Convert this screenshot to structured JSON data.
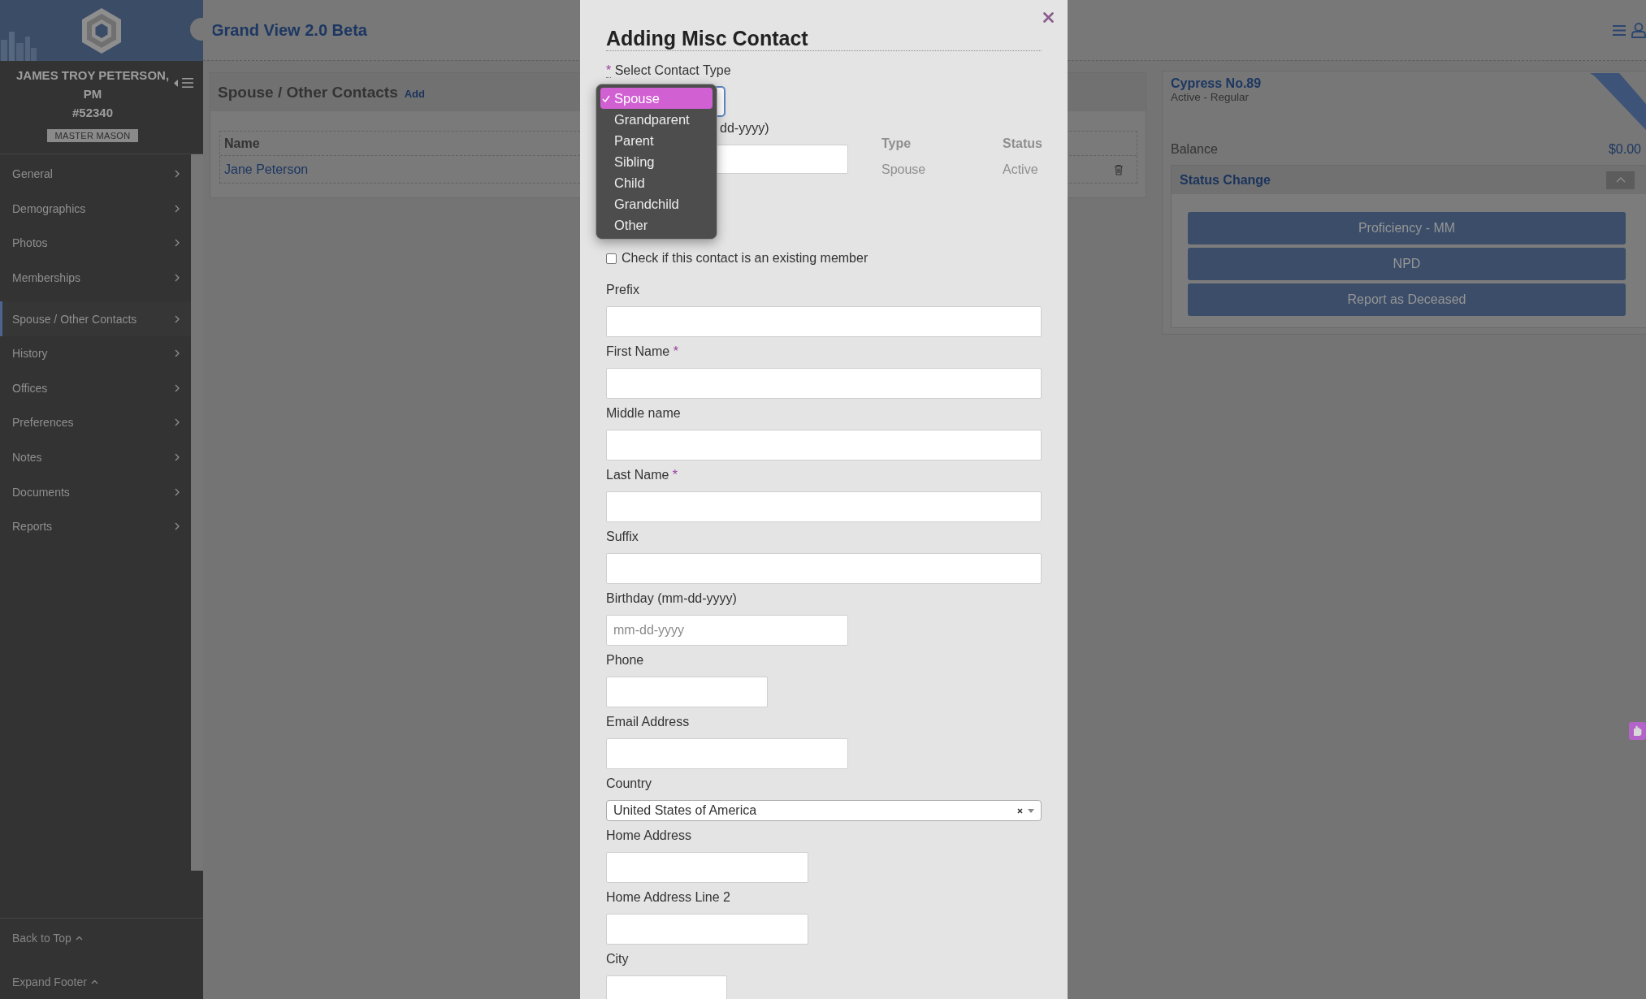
{
  "sidebar": {
    "user_name": "JAMES TROY PETERSON, PM",
    "member_number": "#52340",
    "badge": "MASTER MASON",
    "items": [
      {
        "label": "General",
        "selected": false
      },
      {
        "label": "Demographics",
        "selected": false
      },
      {
        "label": "Photos",
        "selected": false
      },
      {
        "label": "Memberships",
        "selected": false
      },
      {
        "label": "Spouse / Other Contacts",
        "selected": true
      },
      {
        "label": "History",
        "selected": false
      },
      {
        "label": "Offices",
        "selected": false
      },
      {
        "label": "Preferences",
        "selected": false
      },
      {
        "label": "Notes",
        "selected": false
      },
      {
        "label": "Documents",
        "selected": false
      },
      {
        "label": "Reports",
        "selected": false
      }
    ],
    "footer_links": [
      "Back to Top",
      "Expand Footer"
    ]
  },
  "header": {
    "title": "Grand View 2.0 Beta"
  },
  "contacts_panel": {
    "title": "Spouse / Other Contacts",
    "add_link": "Add",
    "table": {
      "columns": [
        "Name",
        "Type",
        "Status"
      ],
      "rows": [
        [
          "Jane Peterson",
          "Spouse",
          "Active"
        ]
      ]
    }
  },
  "lodge_panel": {
    "name": "Cypress No.89",
    "status": "Active - Regular",
    "balance_label": "Balance",
    "balance": "$0.00",
    "status_change": {
      "title": "Status Change",
      "expanded": true,
      "buttons": [
        "Proficiency - MM",
        "NPD",
        "Report as Deceased"
      ]
    }
  },
  "modal": {
    "title": "Adding Misc Contact",
    "contact_type": {
      "required_mark": "*",
      "label": "Select Contact Type",
      "open": true,
      "options": [
        {
          "label": "Spouse",
          "selected": true
        },
        {
          "label": "Grandparent",
          "selected": false
        },
        {
          "label": "Parent",
          "selected": false
        },
        {
          "label": "Sibling",
          "selected": false
        },
        {
          "label": "Child",
          "selected": false
        },
        {
          "label": "Grandchild",
          "selected": false
        },
        {
          "label": "Other",
          "selected": false
        }
      ]
    },
    "partly_covered_label": "dd-yyyy)",
    "existing_member": {
      "label": "Check if this contact is an existing member",
      "checked": false
    },
    "fields": [
      {
        "kind": "text",
        "label": "Prefix"
      },
      {
        "kind": "text",
        "label": "First Name",
        "required_mark": "*"
      },
      {
        "kind": "text",
        "label": "Middle name"
      },
      {
        "kind": "text",
        "label": "Last Name",
        "required_mark": "*"
      },
      {
        "kind": "text",
        "label": "Suffix"
      },
      {
        "kind": "text",
        "label": "Birthday (mm-dd-yyyy)",
        "placeholder": "mm-dd-yyyy"
      },
      {
        "kind": "text",
        "label": "Phone"
      },
      {
        "kind": "text",
        "label": "Email Address"
      },
      {
        "kind": "select",
        "label": "Country",
        "value": "United States of America"
      },
      {
        "kind": "text",
        "label": "Home Address"
      },
      {
        "kind": "text",
        "label": "Home Address Line 2"
      },
      {
        "kind": "text",
        "label": "City"
      }
    ]
  }
}
